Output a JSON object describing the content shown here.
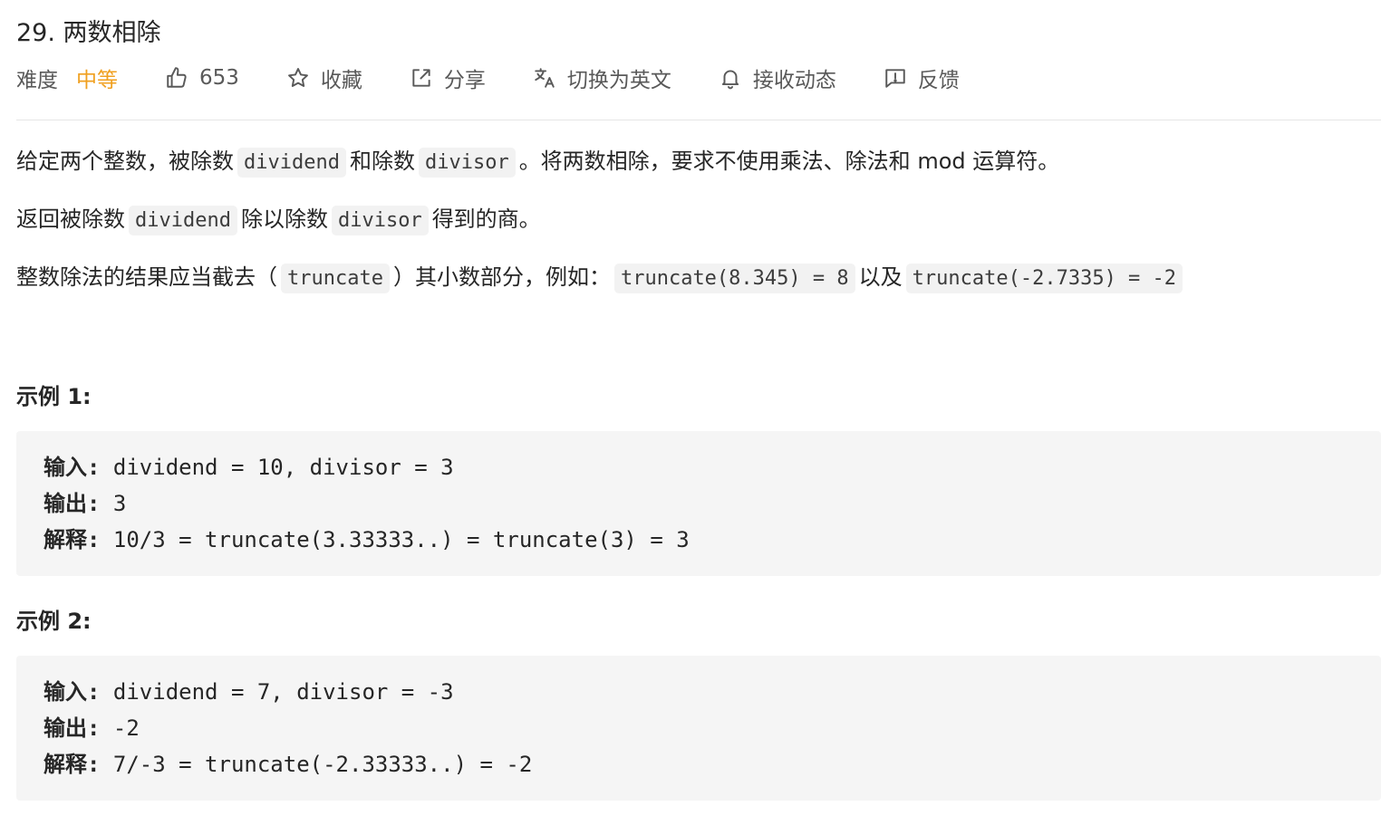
{
  "problem": {
    "title": "29. 两数相除"
  },
  "meta": {
    "difficulty_label": "难度",
    "difficulty_value": "中等",
    "difficulty_color": "#f0a020",
    "likes": "653",
    "favorite_label": "收藏",
    "share_label": "分享",
    "translate_label": "切换为英文",
    "notify_label": "接收动态",
    "feedback_label": "反馈",
    "icons": [
      "thumbs-up-icon",
      "star-icon",
      "share-icon",
      "translate-icon",
      "bell-icon",
      "feedback-icon"
    ]
  },
  "description": {
    "p1_a": "给定两个整数，被除数",
    "p1_code1": "dividend",
    "p1_b": "和除数",
    "p1_code2": "divisor",
    "p1_c": "。将两数相除，要求不使用乘法、除法和 mod 运算符。",
    "p2_a": "返回被除数",
    "p2_code1": "dividend",
    "p2_b": "除以除数",
    "p2_code2": "divisor",
    "p2_c": "得到的商。",
    "p3_a": "整数除法的结果应当截去（",
    "p3_code1": "truncate",
    "p3_b": "）其小数部分，例如：",
    "p3_code2": "truncate(8.345) = 8",
    "p3_c": "以及",
    "p3_code3": "truncate(-2.7335) = -2"
  },
  "examples": [
    {
      "title": "示例 1:",
      "input_label": "输入:",
      "input_value": " dividend = 10, divisor = 3",
      "output_label": "输出:",
      "output_value": " 3",
      "explain_label": "解释:",
      "explain_value": " 10/3 = truncate(3.33333..) = truncate(3) = 3"
    },
    {
      "title": "示例 2:",
      "input_label": "输入:",
      "input_value": " dividend = 7, divisor = -3",
      "output_label": "输出:",
      "output_value": " -2",
      "explain_label": "解释:",
      "explain_value": " 7/-3 = truncate(-2.33333..) = -2"
    }
  ]
}
